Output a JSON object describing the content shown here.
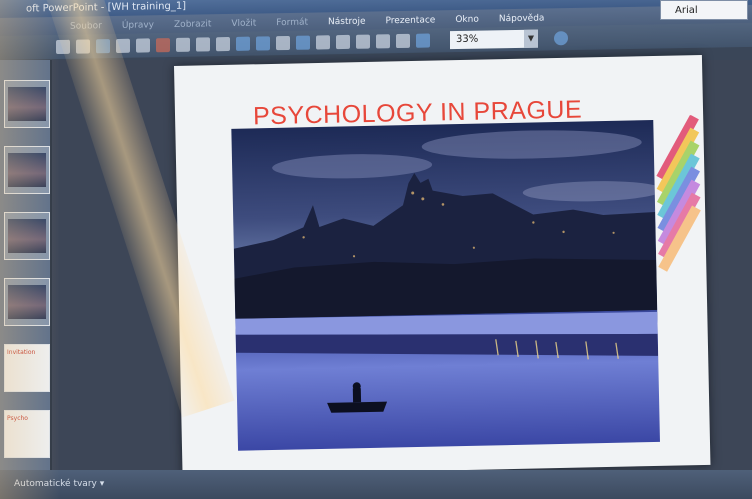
{
  "window": {
    "title": "oft PowerPoint - [WH training_1]"
  },
  "menu": {
    "items": [
      {
        "label": "Soubor",
        "dim": true
      },
      {
        "label": "Úpravy",
        "dim": true
      },
      {
        "label": "Zobrazit",
        "dim": true
      },
      {
        "label": "Vložit",
        "dim": true
      },
      {
        "label": "Formát",
        "dim": true
      },
      {
        "label": "Nástroje",
        "dim": false
      },
      {
        "label": "Prezentace",
        "dim": false
      },
      {
        "label": "Okno",
        "dim": false
      },
      {
        "label": "Nápověda",
        "dim": false
      }
    ]
  },
  "toolbar": {
    "font_name": "Arial",
    "zoom": "33%"
  },
  "slides_pane": {
    "thumbnails": [
      {
        "label": "",
        "white": false
      },
      {
        "label": "",
        "white": false
      },
      {
        "label": "",
        "white": false
      },
      {
        "label": "",
        "white": false
      },
      {
        "label": "Invitation",
        "white": true
      },
      {
        "label": "Psycho",
        "white": true
      }
    ]
  },
  "slide": {
    "title": "PSYCHOLOGY IN PRAGUE",
    "title_color": "#e7473a",
    "stripe_colors": [
      "#e25b7b",
      "#f2c75a",
      "#a8d36a",
      "#6cc6d8",
      "#7a8fe0",
      "#c58adf",
      "#e67aa6",
      "#f6c38a"
    ]
  },
  "statusbar": {
    "autoshapes_label": "Automatické tvary"
  }
}
